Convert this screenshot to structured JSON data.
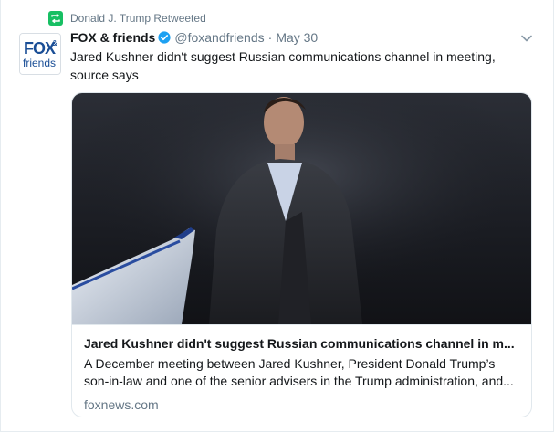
{
  "retweet": {
    "label": "Donald J. Trump Retweeted",
    "icon": "retweet-icon",
    "color": "#17bf63"
  },
  "tweet": {
    "author_name": "FOX & friends",
    "handle": "@foxandfriends",
    "separator": "·",
    "timestamp": "May 30",
    "text": "Jared Kushner didn't suggest Russian communications channel in meeting, source says",
    "verified_color": "#1da1f2"
  },
  "avatar": {
    "logo_top": "FOX",
    "logo_amp": "&",
    "logo_bottom": "friends"
  },
  "card": {
    "title": "Jared Kushner didn't suggest Russian communications channel in m...",
    "description": "A December meeting between Jared Kushner, President Donald Trump’s son-in-law and one of the senior advisers in the Trump administration, and...",
    "domain": "foxnews.com"
  },
  "colors": {
    "text": "#14171a",
    "muted": "#657786",
    "border": "#e1e8ed"
  }
}
